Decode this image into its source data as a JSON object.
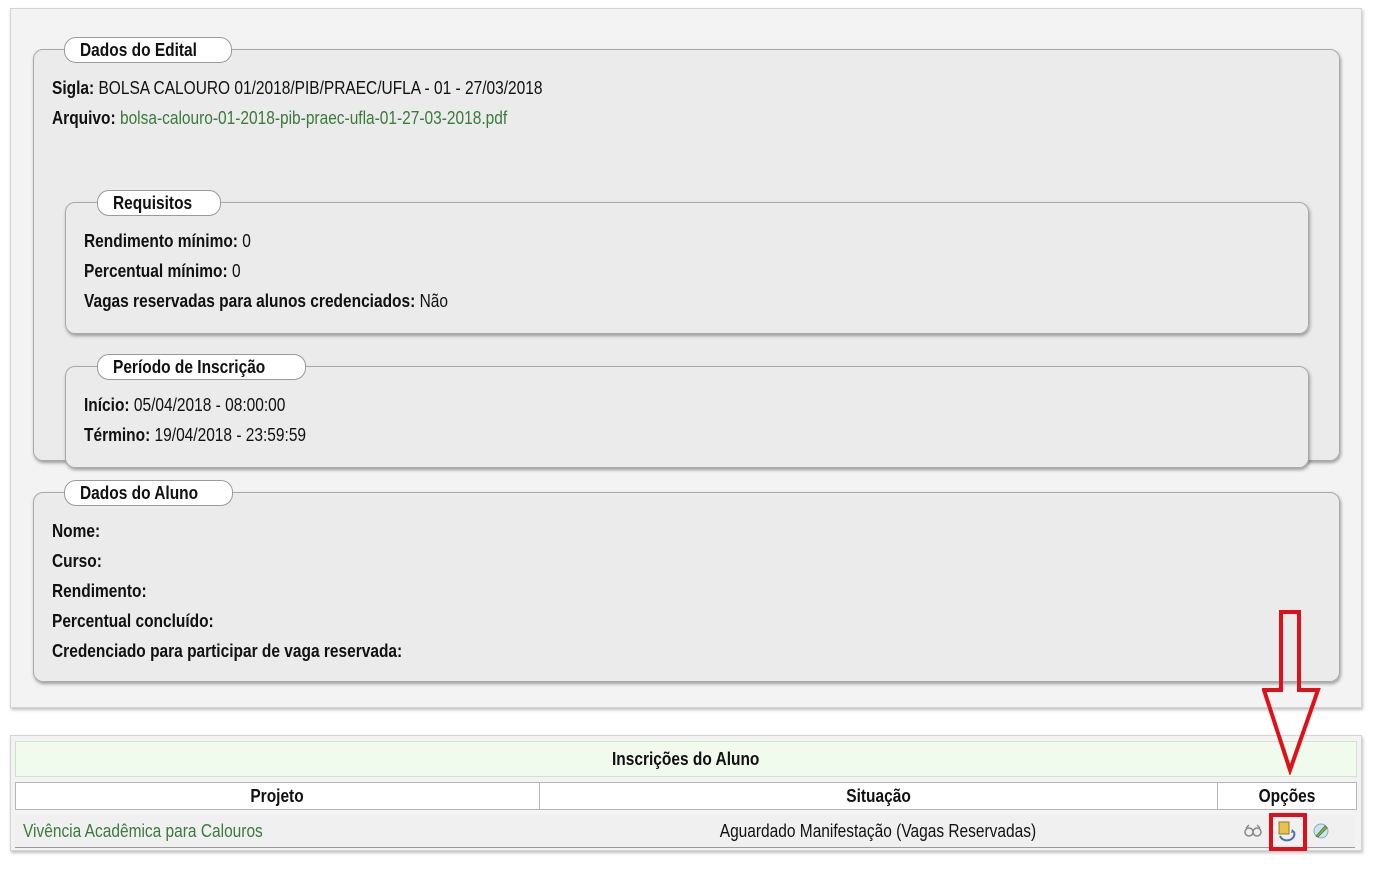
{
  "edital": {
    "legend": "Dados do Edital",
    "sigla_label": "Sigla:",
    "sigla_value": "BOLSA CALOURO 01/2018/PIB/PRAEC/UFLA - 01 - 27/03/2018",
    "arquivo_label": "Arquivo:",
    "arquivo_value": "bolsa-calouro-01-2018-pib-praec-ufla-01-27-03-2018.pdf",
    "requisitos": {
      "legend": "Requisitos",
      "rendimento_label": "Rendimento mínimo:",
      "rendimento_value": "0",
      "percentual_label": "Percentual mínimo:",
      "percentual_value": "0",
      "vagas_label": "Vagas reservadas para alunos credenciados:",
      "vagas_value": "Não"
    },
    "periodo": {
      "legend": "Período de Inscrição",
      "inicio_label": "Início:",
      "inicio_value": "05/04/2018 - 08:00:00",
      "termino_label": "Término:",
      "termino_value": "19/04/2018 - 23:59:59"
    }
  },
  "aluno": {
    "legend": "Dados do Aluno",
    "nome_label": "Nome:",
    "curso_label": "Curso:",
    "rendimento_label": "Rendimento:",
    "percentual_label": "Percentual concluído:",
    "credenciado_label": "Credenciado para participar de vaga reservada:"
  },
  "inscricoes": {
    "title": "Inscrições do Aluno",
    "headers": [
      "Projeto",
      "Situação",
      "Opções"
    ],
    "rows": [
      {
        "projeto": "Vivência Acadêmica para Calouros",
        "situacao": "Aguardado Manifestação (Vagas Reservadas)",
        "options": [
          "view-icon",
          "manifest-icon",
          "edit-icon"
        ]
      }
    ]
  },
  "annotation": {
    "color": "#e0101a",
    "arrow_icon": "arrow-down-icon",
    "highlight_target": "manifest-icon"
  }
}
